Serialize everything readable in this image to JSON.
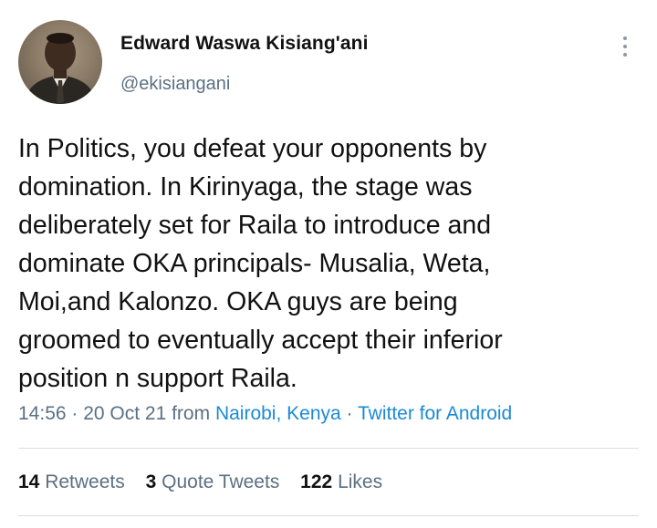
{
  "author": {
    "display_name": "Edward Waswa Kisiang'ani",
    "handle": "@ekisiangani",
    "avatar_icon": "profile-photo"
  },
  "tweet": {
    "lines": [
      "In Politics, you defeat your opponents by",
      "domination. In Kirinyaga, the stage was",
      "deliberately set for Raila to introduce and",
      "dominate OKA principals- Musalia, Weta,",
      "Moi,and Kalonzo. OKA guys are being",
      "groomed to eventually accept their  inferior",
      "position n support Raila."
    ]
  },
  "meta": {
    "time_date": "14:56 · 20 Oct 21 from ",
    "location": "Nairobi, Kenya",
    "separator": " · ",
    "source": "Twitter for Android"
  },
  "stats": {
    "retweets_count": "14",
    "retweets_label": "Retweets",
    "quotes_count": "3",
    "quotes_label": "Quote Tweets",
    "likes_count": "122",
    "likes_label": "Likes"
  },
  "colors": {
    "link": "#1b8ad6",
    "secondary": "#5b7083",
    "text": "#111111"
  }
}
